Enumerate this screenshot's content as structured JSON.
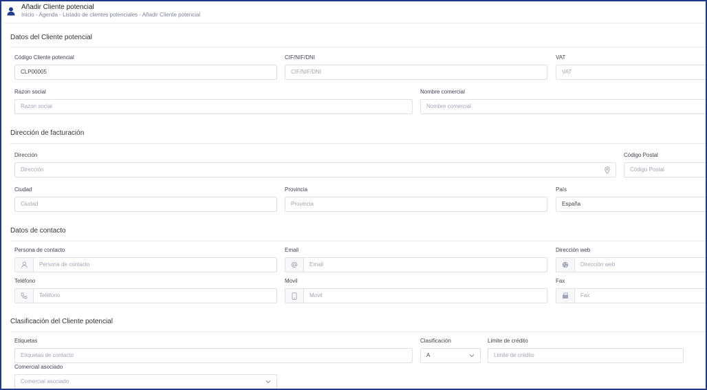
{
  "header": {
    "title": "Añadir Cliente potencial",
    "breadcrumb": [
      "Inicio",
      "Agenda",
      "Listado de clientes potenciales",
      "Añadir Cliente potencial"
    ],
    "breadcrumb_sep": " - "
  },
  "sections": {
    "datos": "Datos del Cliente potencial",
    "facturacion": "Dirección de facturación",
    "contacto": "Datos de contacto",
    "clasificacion": "Clasificación del Cliente potencial"
  },
  "fields": {
    "codigo": {
      "label": "Código Cliente potencial",
      "value": "CLP00005"
    },
    "cif": {
      "label": "CIF/NIF/DNI",
      "placeholder": "CIF/NIF/DNI"
    },
    "vat": {
      "label": "VAT",
      "placeholder": "VAT"
    },
    "razon_social": {
      "label": "Razon social",
      "placeholder": "Razon social"
    },
    "nombre_comercial": {
      "label": "Nombre comercial",
      "placeholder": "Nombre comercial"
    },
    "direccion": {
      "label": "Dirección",
      "placeholder": "Dirección"
    },
    "codigo_postal": {
      "label": "Código Postal",
      "placeholder": "Código Postal"
    },
    "ciudad": {
      "label": "Ciudad",
      "placeholder": "Ciudad"
    },
    "provincia": {
      "label": "Provincia",
      "placeholder": "Provincia"
    },
    "pais": {
      "label": "País",
      "value": "España"
    },
    "persona_contacto": {
      "label": "Persona de contacto",
      "placeholder": "Persona de contacto"
    },
    "email": {
      "label": "Email",
      "placeholder": "Email"
    },
    "web": {
      "label": "Dirección web",
      "placeholder": "Dirección web"
    },
    "telefono": {
      "label": "Teléfono",
      "placeholder": "Teléfono"
    },
    "movil": {
      "label": "Movil",
      "placeholder": "Movil"
    },
    "fax": {
      "label": "Fax",
      "placeholder": "Fax"
    },
    "etiquetas": {
      "label": "Etiquetas",
      "placeholder": "Etiquetas de contacto"
    },
    "clasificacion": {
      "label": "Clasificación",
      "value": "A"
    },
    "limite_credito": {
      "label": "Limite de crédito",
      "placeholder": "Limite de crédito"
    },
    "comercial": {
      "label": "Comercial asociado",
      "placeholder": "Comercial asociado"
    }
  },
  "icons": {
    "user": "user-icon",
    "location": "map-pin-icon",
    "person": "person-icon",
    "email": "at-sign-icon",
    "web": "globe-icon",
    "phone": "phone-icon",
    "mobile": "mobile-icon",
    "fax": "fax-icon",
    "chevron": "chevron-down-icon"
  },
  "colors": {
    "frame_border": "#1e3a8a",
    "accent": "#1e3a8a",
    "field_border": "#dfe1e8"
  }
}
